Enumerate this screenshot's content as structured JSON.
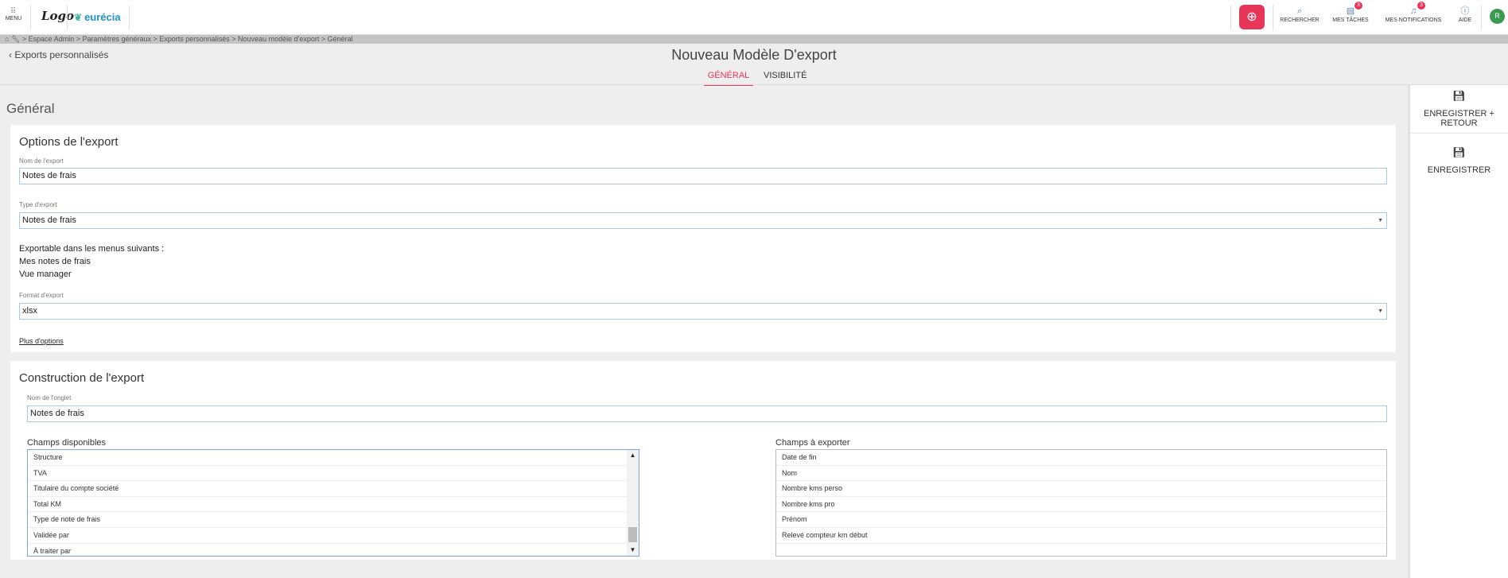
{
  "topbar": {
    "menu_label": "MENU",
    "logo_text": "Logo",
    "brand_name": "eurécia",
    "add_icon": "plus-circle-icon",
    "search_label": "RECHERCHER",
    "tasks_label": "MES TÂCHES",
    "tasks_count": "3",
    "notifications_label": "MES NOTIFICATIONS",
    "notifications_count": "3",
    "help_label": "AIDE",
    "avatar_initial": "R",
    "accent_color": "#e8365b"
  },
  "breadcrumb": {
    "text": "> Espace Admin > Paramètres généraux > Exports personnalisés > Nouveau modèle d'export > Général"
  },
  "header": {
    "back_label": "Exports personnalisés",
    "title": "Nouveau Modèle D'export",
    "tabs": [
      {
        "label": "GÉNÉRAL",
        "active": true
      },
      {
        "label": "VISIBILITÉ",
        "active": false
      }
    ]
  },
  "main": {
    "section_title": "Général",
    "options": {
      "title": "Options de l'export",
      "name_label": "Nom de l'export",
      "name_value": "Notes de frais",
      "type_label": "Type d'export",
      "type_value": "Notes de frais",
      "exportable_title": "Exportable dans les menus suivants :",
      "exportable_menus": [
        "Mes notes de frais",
        "Vue manager"
      ],
      "format_label": "Format d'export",
      "format_value": "xlsx",
      "more_options": "Plus d'options"
    },
    "construction": {
      "title": "Construction de l'export",
      "tab_name_label": "Nom de l'onglet",
      "tab_name_value": "Notes de frais",
      "available_label": "Champs disponibles",
      "available_fields": [
        "Structure",
        "TVA",
        "Titulaire du compte société",
        "Total KM",
        "Type de note de frais",
        "Validée par",
        "À traiter par"
      ],
      "export_label": "Champs à exporter",
      "export_fields": [
        "Date de fin",
        "Nom",
        "Nombre kms perso",
        "Nombre kms pro",
        "Prénom",
        "Relevé compteur km début"
      ]
    }
  },
  "actions": {
    "save_return": "ENREGISTRER + RETOUR",
    "save": "ENREGISTRER",
    "save_icon": "floppy-disk-icon"
  }
}
